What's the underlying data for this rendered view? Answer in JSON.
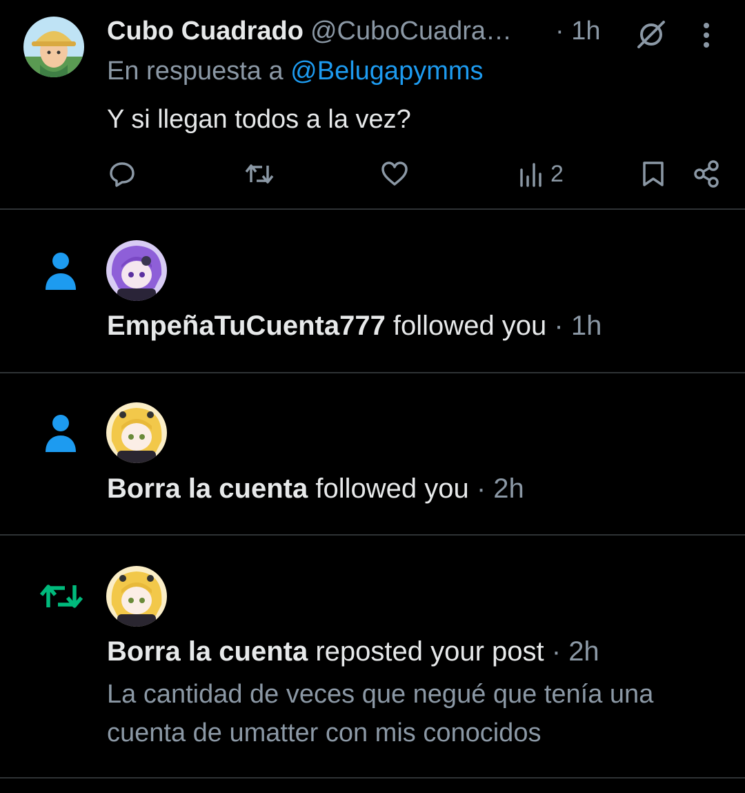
{
  "reply_tweet": {
    "author_name": "Cubo Cuadrado",
    "author_handle": "@CuboCuadra…",
    "time": "· 1h",
    "reply_prefix": "En respuesta a",
    "reply_mention": "@Belugapymms",
    "text": "Y si llegan todos a la vez?",
    "views_count": "2",
    "icons": [
      "reply-icon",
      "repost-icon",
      "like-icon",
      "views-icon",
      "bookmark-icon",
      "share-icon",
      "grok-icon",
      "more-icon"
    ]
  },
  "notifications": [
    {
      "type": "follow",
      "icon": "person-icon",
      "who": "EmpeñaTuCuenta777",
      "action": " followed you",
      "time": " · 1h"
    },
    {
      "type": "follow",
      "icon": "person-icon",
      "who": "Borra la cuenta",
      "action": " followed you",
      "time": " · 2h"
    },
    {
      "type": "repost",
      "icon": "repost-icon",
      "who": "Borra la cuenta",
      "action": " reposted your post",
      "time": " · 2h",
      "quote": "La cantidad de veces que negué que tenía una cuenta de umatter con mis conocidos"
    }
  ],
  "colors": {
    "background": "#000000",
    "text": "#e7e9ea",
    "secondary": "#8b98a5",
    "accent_blue": "#1d9bf0",
    "repost_green": "#00ba7c",
    "divider": "#2f3336"
  }
}
